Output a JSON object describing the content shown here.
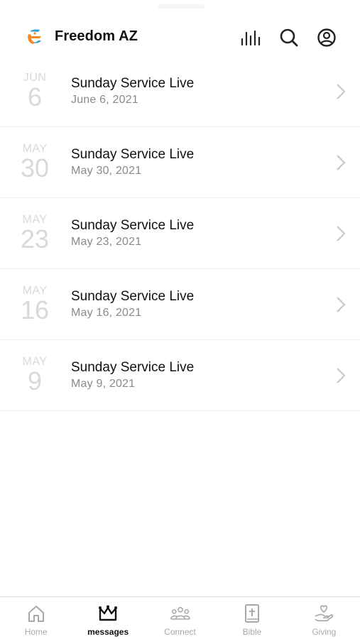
{
  "header": {
    "title": "Freedom AZ",
    "icons": [
      "logo",
      "audio-bars-icon",
      "search-icon",
      "account-icon"
    ]
  },
  "messages": [
    {
      "month": "JUN",
      "day": "6",
      "title": "Sunday Service Live",
      "date": "June 6, 2021"
    },
    {
      "month": "MAY",
      "day": "30",
      "title": "Sunday Service Live",
      "date": "May 30, 2021"
    },
    {
      "month": "MAY",
      "day": "23",
      "title": "Sunday Service Live",
      "date": "May 23, 2021"
    },
    {
      "month": "MAY",
      "day": "16",
      "title": "Sunday Service Live",
      "date": "May 16, 2021"
    },
    {
      "month": "MAY",
      "day": "9",
      "title": "Sunday Service Live",
      "date": "May 9, 2021"
    }
  ],
  "tabs": [
    {
      "label": "Home",
      "icon": "home-icon",
      "active": false
    },
    {
      "label": "messages",
      "icon": "crown-icon",
      "active": true
    },
    {
      "label": "Connect",
      "icon": "people-icon",
      "active": false
    },
    {
      "label": "Bible",
      "icon": "bible-icon",
      "active": false
    },
    {
      "label": "Giving",
      "icon": "giving-hand-icon",
      "active": false
    }
  ],
  "colors": {
    "accent": "#111111",
    "inactive": "#a8a8a8",
    "date_faded": "#d9d9d9",
    "logo_orange": "#f08a24",
    "logo_blue": "#2a9fd6"
  }
}
